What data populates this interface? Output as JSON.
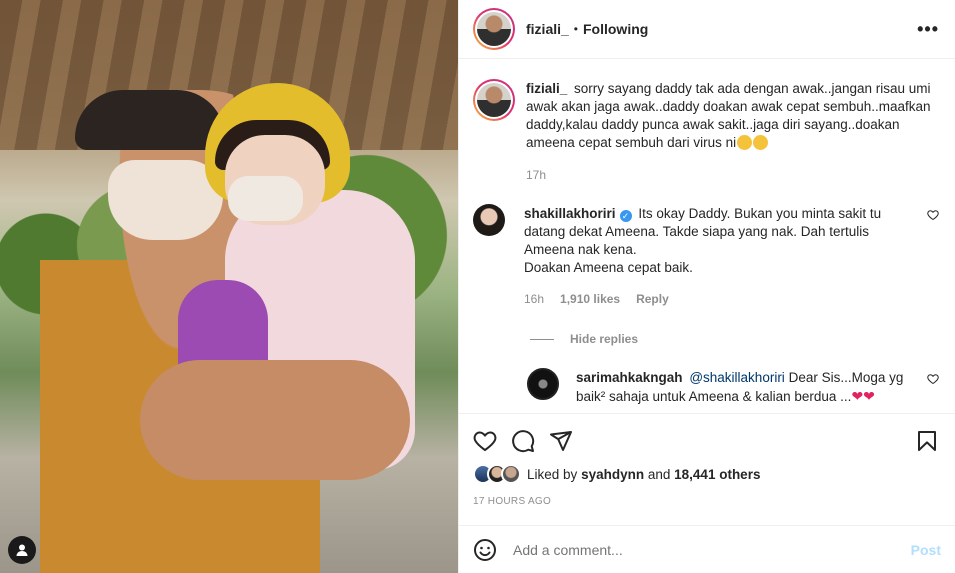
{
  "post": {
    "author": "fiziali_",
    "separator": "•",
    "follow_status": "Following",
    "more_label": "•••"
  },
  "caption": {
    "username": "fiziali_",
    "text": "sorry sayang daddy tak ada dengan awak..jangan risau umi awak akan jaga awak..daddy doakan awak cepat sembuh..maafkan daddy,kalau daddy punca awak sakit..jaga diri sayang..doakan ameena cepat sembuh dari virus ni",
    "emojis": [
      "pensive-face-emoji",
      "pensive-face-emoji"
    ],
    "time": "17h"
  },
  "comments": [
    {
      "username": "shakillakhoriri",
      "verified": true,
      "text_lines": [
        "Its okay Daddy. Bukan you minta sakit tu datang dekat Ameena. Takde siapa yang nak. Dah tertulis Ameena nak kena.",
        "Doakan Ameena cepat baik."
      ],
      "time": "16h",
      "likes": "1,910 likes",
      "reply_label": "Reply",
      "hide_replies": "Hide replies"
    }
  ],
  "reply": {
    "username": "sarimahkakngah",
    "mention": "@shakillakhoriri",
    "text": "Dear Sis...Moga yg baik² sahaja untuk Ameena & kalian berdua ...",
    "emojis": [
      "red-heart-emoji",
      "red-heart-emoji"
    ]
  },
  "likes_summary": {
    "prefix": "Liked by",
    "user": "syahdynn",
    "conjunction": "and",
    "others": "18,441 others"
  },
  "posted_ago": "17 HOURS AGO",
  "add_comment": {
    "placeholder": "Add a comment...",
    "post_label": "Post"
  },
  "icons": {
    "like": "heart-icon",
    "comment": "comment-icon",
    "share": "share-icon",
    "save": "bookmark-icon",
    "emoji": "smiley-icon",
    "tag": "user-tag-icon"
  },
  "colors": {
    "text": "#262626",
    "muted": "#8e8e8e",
    "verified": "#3897f0",
    "post_disabled": "#b2dffc",
    "heart": "#e0245e"
  }
}
